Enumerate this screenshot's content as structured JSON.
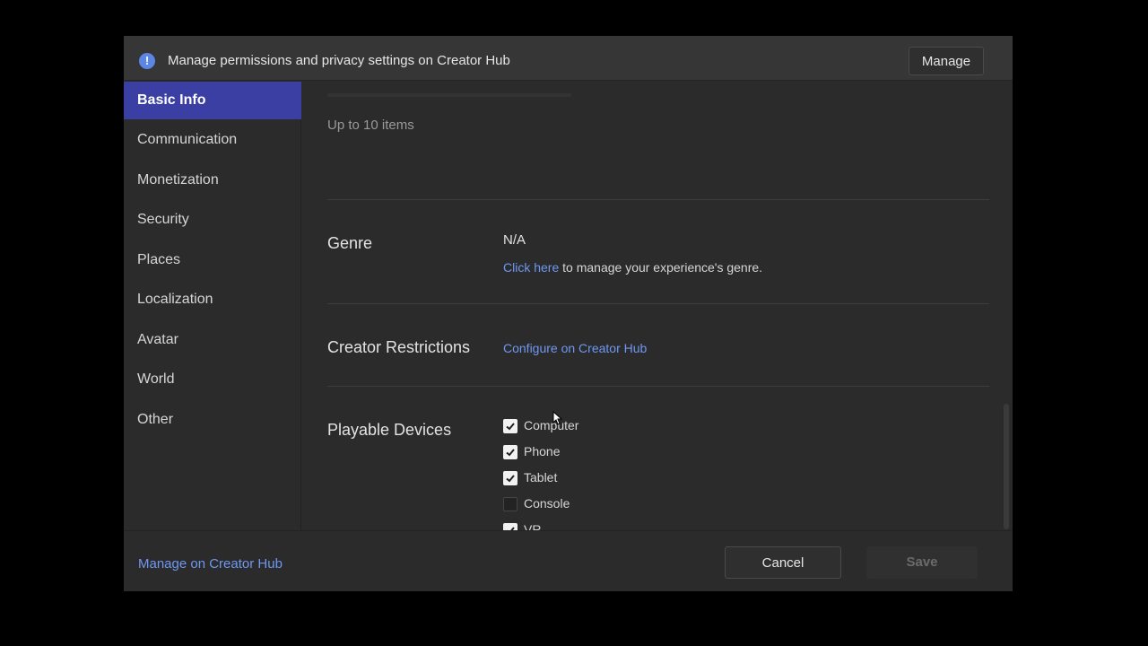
{
  "banner": {
    "info_icon": "info-icon",
    "text": "Manage permissions and privacy settings on Creator Hub",
    "manage_label": "Manage"
  },
  "sidebar": {
    "items": [
      {
        "label": "Basic Info",
        "active": true
      },
      {
        "label": "Communication",
        "active": false
      },
      {
        "label": "Monetization",
        "active": false
      },
      {
        "label": "Security",
        "active": false
      },
      {
        "label": "Places",
        "active": false
      },
      {
        "label": "Localization",
        "active": false
      },
      {
        "label": "Avatar",
        "active": false
      },
      {
        "label": "World",
        "active": false
      },
      {
        "label": "Other",
        "active": false
      }
    ]
  },
  "content": {
    "items_hint": "Up to 10 items",
    "genre": {
      "label": "Genre",
      "value": "N/A",
      "link_text": "Click here",
      "link_suffix": " to manage your experience's genre."
    },
    "creator_restrictions": {
      "label": "Creator Restrictions",
      "link_text": "Configure on Creator Hub"
    },
    "playable_devices": {
      "label": "Playable Devices",
      "options": [
        {
          "label": "Computer",
          "checked": true
        },
        {
          "label": "Phone",
          "checked": true
        },
        {
          "label": "Tablet",
          "checked": true
        },
        {
          "label": "Console",
          "checked": false
        },
        {
          "label": "VR",
          "checked": true
        }
      ]
    }
  },
  "footer": {
    "hub_link": "Manage on Creator Hub",
    "cancel_label": "Cancel",
    "save_label": "Save"
  },
  "colors": {
    "accent": "#3b3fa3",
    "link": "#6f97f2",
    "background": "#2b2b2b"
  }
}
